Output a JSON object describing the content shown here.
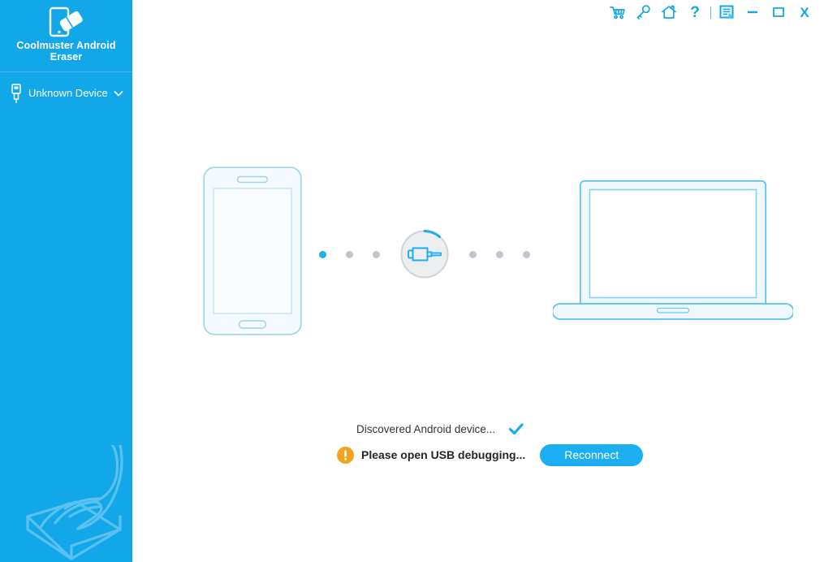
{
  "app": {
    "name": "Coolmuster Android Eraser",
    "logo_icon": "phone-eraser-logo-icon",
    "sidebar_color": "#12A7E8",
    "accent_color": "#1BAEF0",
    "warning_color": "#F5A31E"
  },
  "sidebar": {
    "brand_label": "Coolmuster Android Eraser",
    "device": {
      "label": "Unknown Device",
      "usb_icon": "usb-icon",
      "chevron_icon": "chevron-down-icon"
    },
    "watermark_icon": "hand-holding-eraser-icon"
  },
  "titlebar": {
    "buttons": [
      {
        "name": "cart-icon",
        "title": "Buy"
      },
      {
        "name": "key-icon",
        "title": "Register"
      },
      {
        "name": "home-icon",
        "title": "Home"
      },
      {
        "name": "help-icon",
        "title": "Help",
        "glyph": "?"
      },
      {
        "name": "feedback-icon",
        "title": "Feedback"
      },
      {
        "name": "minimize-icon",
        "title": "Minimize"
      },
      {
        "name": "maximize-icon",
        "title": "Maximize"
      },
      {
        "name": "close-icon",
        "title": "Close",
        "glyph": "X"
      }
    ]
  },
  "stage": {
    "phone_icon": "android-phone-illustration",
    "laptop_icon": "laptop-illustration",
    "connector_icon": "usb-plug-icon",
    "spinner_label": "connecting-spinner",
    "dots_left": [
      "active",
      "idle",
      "idle"
    ],
    "dots_right": [
      "idle",
      "idle",
      "idle"
    ]
  },
  "status": {
    "line1": {
      "text": "Discovered Android device...",
      "icon": "check-icon"
    },
    "line2": {
      "text": "Please open USB debugging...",
      "icon": "warning-icon"
    },
    "reconnect_label": "Reconnect"
  }
}
